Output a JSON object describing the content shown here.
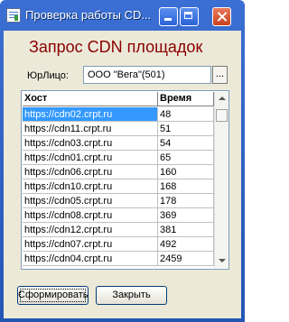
{
  "window": {
    "title": "Проверка работы CD...",
    "icon": "document-list-icon",
    "buttons": [
      "minimize-icon",
      "maximize-icon",
      "close-icon"
    ]
  },
  "heading": "Запрос CDN площадок",
  "legal_entity": {
    "label": "ЮрЛицо:",
    "value": "ООО \"Вега\"(501)",
    "picker_label": "..."
  },
  "grid": {
    "columns": [
      "Хост",
      "Время"
    ],
    "rows": [
      {
        "host": "https://cdn02.crpt.ru",
        "time": "48"
      },
      {
        "host": "https://cdn11.crpt.ru",
        "time": "51"
      },
      {
        "host": "https://cdn03.crpt.ru",
        "time": "54"
      },
      {
        "host": "https://cdn01.crpt.ru",
        "time": "65"
      },
      {
        "host": "https://cdn06.crpt.ru",
        "time": "160"
      },
      {
        "host": "https://cdn10.crpt.ru",
        "time": "168"
      },
      {
        "host": "https://cdn05.crpt.ru",
        "time": "178"
      },
      {
        "host": "https://cdn08.crpt.ru",
        "time": "369"
      },
      {
        "host": "https://cdn12.crpt.ru",
        "time": "381"
      },
      {
        "host": "https://cdn07.crpt.ru",
        "time": "492"
      },
      {
        "host": "https://cdn04.crpt.ru",
        "time": "2459"
      }
    ]
  },
  "buttons": {
    "form": "Сформировать",
    "close": "Закрыть"
  },
  "colors": {
    "heading": "#8b0000",
    "selection": "#3399ff",
    "titlebar": "#2456b5"
  }
}
